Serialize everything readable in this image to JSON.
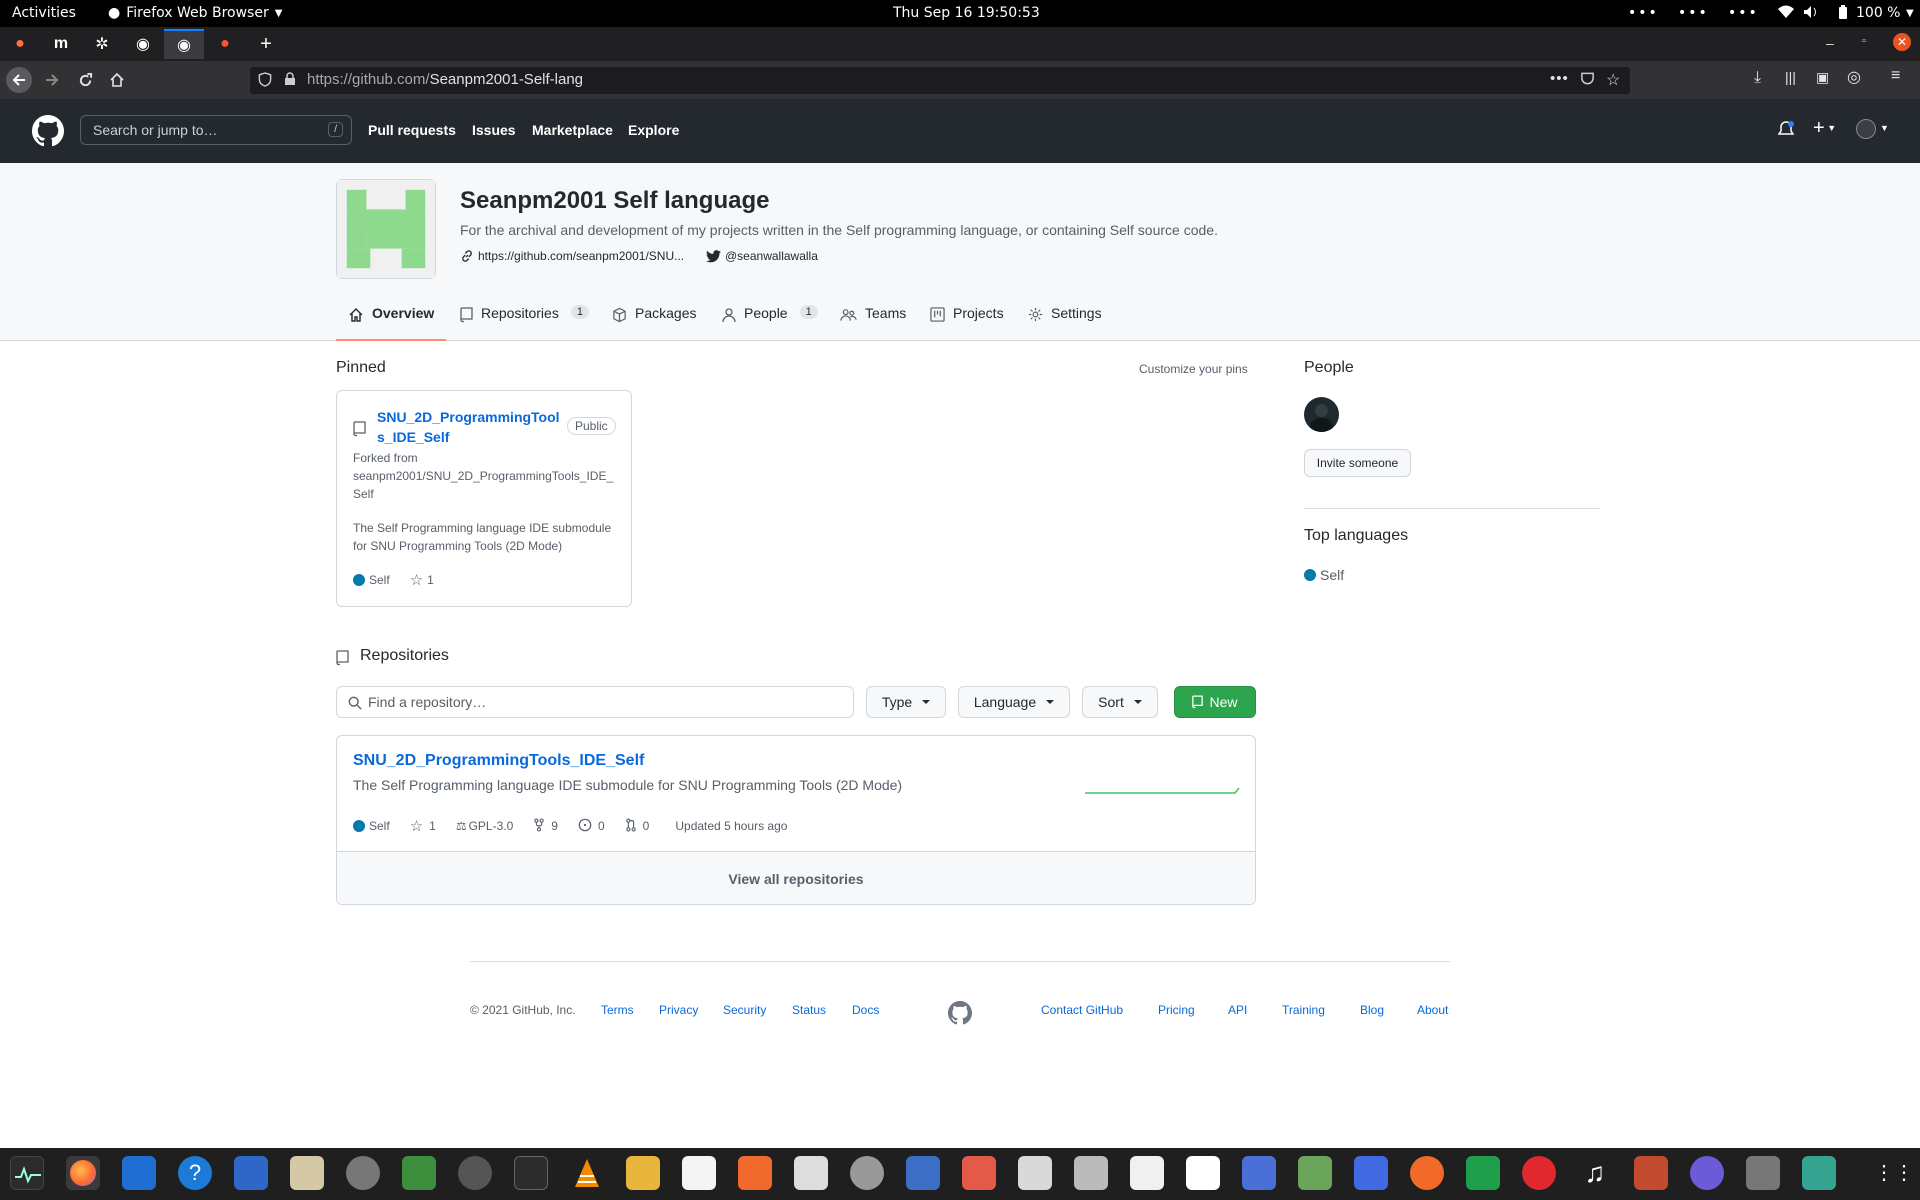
{
  "system": {
    "activities": "Activities",
    "app_name": "Firefox Web Browser",
    "clock": "Thu Sep 16  19:50:53",
    "battery": "100 %"
  },
  "browser": {
    "url_host": "https://github.com/",
    "url_path": "Seanpm2001-Self-lang"
  },
  "gh_header": {
    "search_placeholder": "Search or jump to…",
    "slash_key": "/",
    "nav": [
      "Pull requests",
      "Issues",
      "Marketplace",
      "Explore"
    ]
  },
  "org": {
    "name": "Seanpm2001 Self language",
    "description": "For the archival and development of my projects written in the Self programming language, or containing Self source code.",
    "website": "https://github.com/seanpm2001/SNU...",
    "twitter": "@seanwallawalla",
    "tabs": [
      {
        "label": "Overview",
        "count": ""
      },
      {
        "label": "Repositories",
        "count": "1"
      },
      {
        "label": "Packages",
        "count": ""
      },
      {
        "label": "People",
        "count": "1"
      },
      {
        "label": "Teams",
        "count": ""
      },
      {
        "label": "Projects",
        "count": ""
      },
      {
        "label": "Settings",
        "count": ""
      }
    ]
  },
  "pinned": {
    "heading": "Pinned",
    "customize": "Customize your pins",
    "repo_name": "SNU_2D_ProgrammingTools_IDE_Self",
    "repo_name_line1": "SNU_2D_ProgrammingTool",
    "repo_name_line2": "s_IDE_Self",
    "visibility": "Public",
    "forked_line1": "Forked from",
    "forked_line2": "seanpm2001/SNU_2D_ProgrammingTools_IDE_",
    "forked_line3": "Self",
    "desc_line1": "The Self Programming language IDE submodule",
    "desc_line2": "for SNU Programming Tools (2D Mode)",
    "language": "Self",
    "stars": "1"
  },
  "repositories": {
    "heading": "Repositories",
    "find_placeholder": "Find a repository…",
    "type_label": "Type",
    "language_label": "Language",
    "sort_label": "Sort",
    "new_label": "New",
    "items": [
      {
        "name": "SNU_2D_ProgrammingTools_IDE_Self",
        "description": "The Self Programming language IDE submodule for SNU Programming Tools (2D Mode)",
        "language": "Self",
        "stars": "1",
        "license": "GPL-3.0",
        "forks": "9",
        "issues": "0",
        "pulls": "0",
        "updated": "Updated 5 hours ago"
      }
    ],
    "view_all": "View all repositories"
  },
  "sidebar": {
    "people_heading": "People",
    "invite_label": "Invite someone",
    "top_languages_heading": "Top languages",
    "language": "Self"
  },
  "footer": {
    "copyright": "© 2021 GitHub, Inc.",
    "left_links": [
      "Terms",
      "Privacy",
      "Security",
      "Status",
      "Docs"
    ],
    "right_links": [
      "Contact GitHub",
      "Pricing",
      "API",
      "Training",
      "Blog",
      "About"
    ]
  },
  "colors": {
    "lang_self": "#0579aa",
    "accent": "#0969da",
    "new_button": "#2da44e",
    "tab_underline": "#fd8c73"
  }
}
